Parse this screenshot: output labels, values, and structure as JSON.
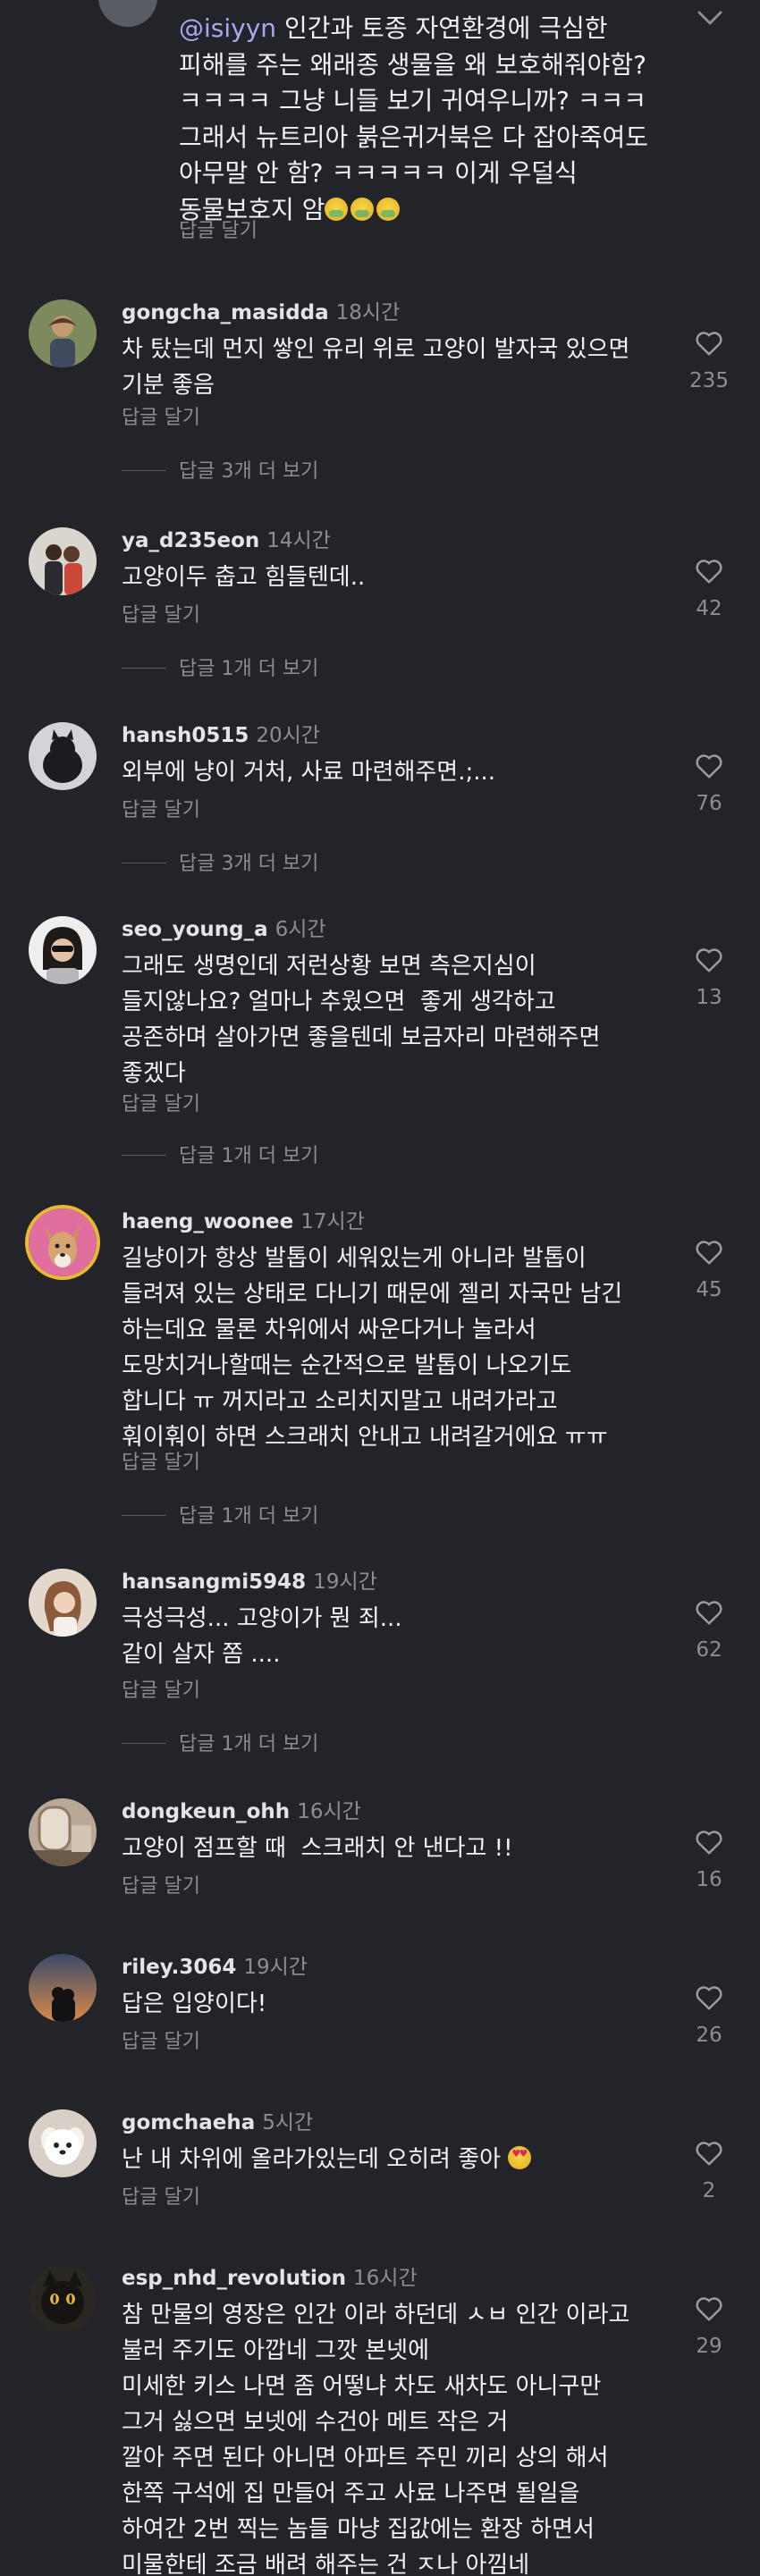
{
  "top_reply": {
    "mention": "@isiyyn",
    "text": " 인간과 토종 자연환경에 극심한\n피해를 주는 왜래종 생물을 왜 보호해줘야함?\nㅋㅋㅋㅋ 그냥 니들 보기 귀여우니까? ㅋㅋㅋ\n그래서 뉴트리아 붉은귀거북은 다 잡아죽여도\n아무말 안 함? ㅋㅋㅋㅋㅋ 이게 우덜식\n동물보호지 암",
    "emojis": [
      "sick-face",
      "sick-face",
      "sick-face"
    ],
    "reply_label": "답글 달기"
  },
  "reply_label": "답글 달기",
  "comments": [
    {
      "username": "gongcha_masidda",
      "time": "18시간",
      "text": "차 탔는데 먼지 쌓인 유리 위로 고양이 발자국 있으면\n기분 좋음",
      "likes": "235",
      "view_replies": "답글 3개 더 보기"
    },
    {
      "username": "ya_d235eon",
      "time": "14시간",
      "text": "고양이두 춥고 힘들텐데..",
      "likes": "42",
      "view_replies": "답글 1개 더 보기"
    },
    {
      "username": "hansh0515",
      "time": "20시간",
      "text": "외부에 냥이 거처, 사료 마련해주면.;...",
      "likes": "76",
      "view_replies": "답글 3개 더 보기"
    },
    {
      "username": "seo_young_a",
      "time": "6시간",
      "text": "그래도 생명인데 저런상황 보면 측은지심이\n들지않나요? 얼마나 추웠으면  좋게 생각하고\n공존하며 살아가면 좋을텐데 보금자리 마련해주면\n좋겠다",
      "likes": "13",
      "view_replies": "답글 1개 더 보기"
    },
    {
      "username": "haeng_woonee",
      "time": "17시간",
      "text": "길냥이가 항상 발톱이 세워있는게 아니라 발톱이\n들려져 있는 상태로 다니기 때문에 젤리 자국만 남긴\n하는데요 물론 차위에서 싸운다거나 놀라서\n도망치거나할때는 순간적으로 발톱이 나오기도\n합니다 ㅠ 꺼지라고 소리치지말고 내려가라고\n훠이훠이 하면 스크래치 안내고 내려갈거에요 ㅠㅠ",
      "likes": "45",
      "view_replies": "답글 1개 더 보기"
    },
    {
      "username": "hansangmi5948",
      "time": "19시간",
      "text": "극성극성... 고양이가 뭔 죄...\n같이 살자 쫌 ....",
      "likes": "62",
      "view_replies": "답글 1개 더 보기"
    },
    {
      "username": "dongkeun_ohh",
      "time": "16시간",
      "text": "고양이 점프할 때  스크래치 안 낸다고 !!",
      "likes": "16",
      "view_replies": ""
    },
    {
      "username": "riley.3064",
      "time": "19시간",
      "text": "답은 입양이다!",
      "likes": "26",
      "view_replies": ""
    },
    {
      "username": "gomchaeha",
      "time": "5시간",
      "text": "난 내 차위에 올라가있는데 오히려 좋아 ",
      "likes": "2",
      "view_replies": "",
      "emoji": "heart-eyes-face"
    },
    {
      "username": "esp_nhd_revolution",
      "time": "16시간",
      "text": "참 만물의 영장은 인간 이라 하던데 ㅅㅂ 인간 이라고\n불러 주기도 아깝네 그깟 본넷에\n미세한 키스 나면 좀 어떻냐 차도 새차도 아니구만\n그거 싫으면 보넷에 수건아 메트 작은 거\n깔아 주면 된다 아니면 아파트 주민 끼리 상의 해서\n한쪽 구석에 집 만들어 주고 사료 나주면 될일을\n하여간 2번 찍는 놈들 마냥 집값에는 환장 하면서\n미물한테 조금 배려 해주는 건 ㅈ나 아낌네",
      "likes": "29",
      "view_replies": ""
    }
  ],
  "icons": {
    "like": "heart-outline-icon",
    "collapse": "chevron-down-icon"
  },
  "colors": {
    "background": "#232429",
    "mention": "#a6a9f2",
    "secondary": "#8c8e96",
    "avatar_ring": "#e8b931"
  }
}
